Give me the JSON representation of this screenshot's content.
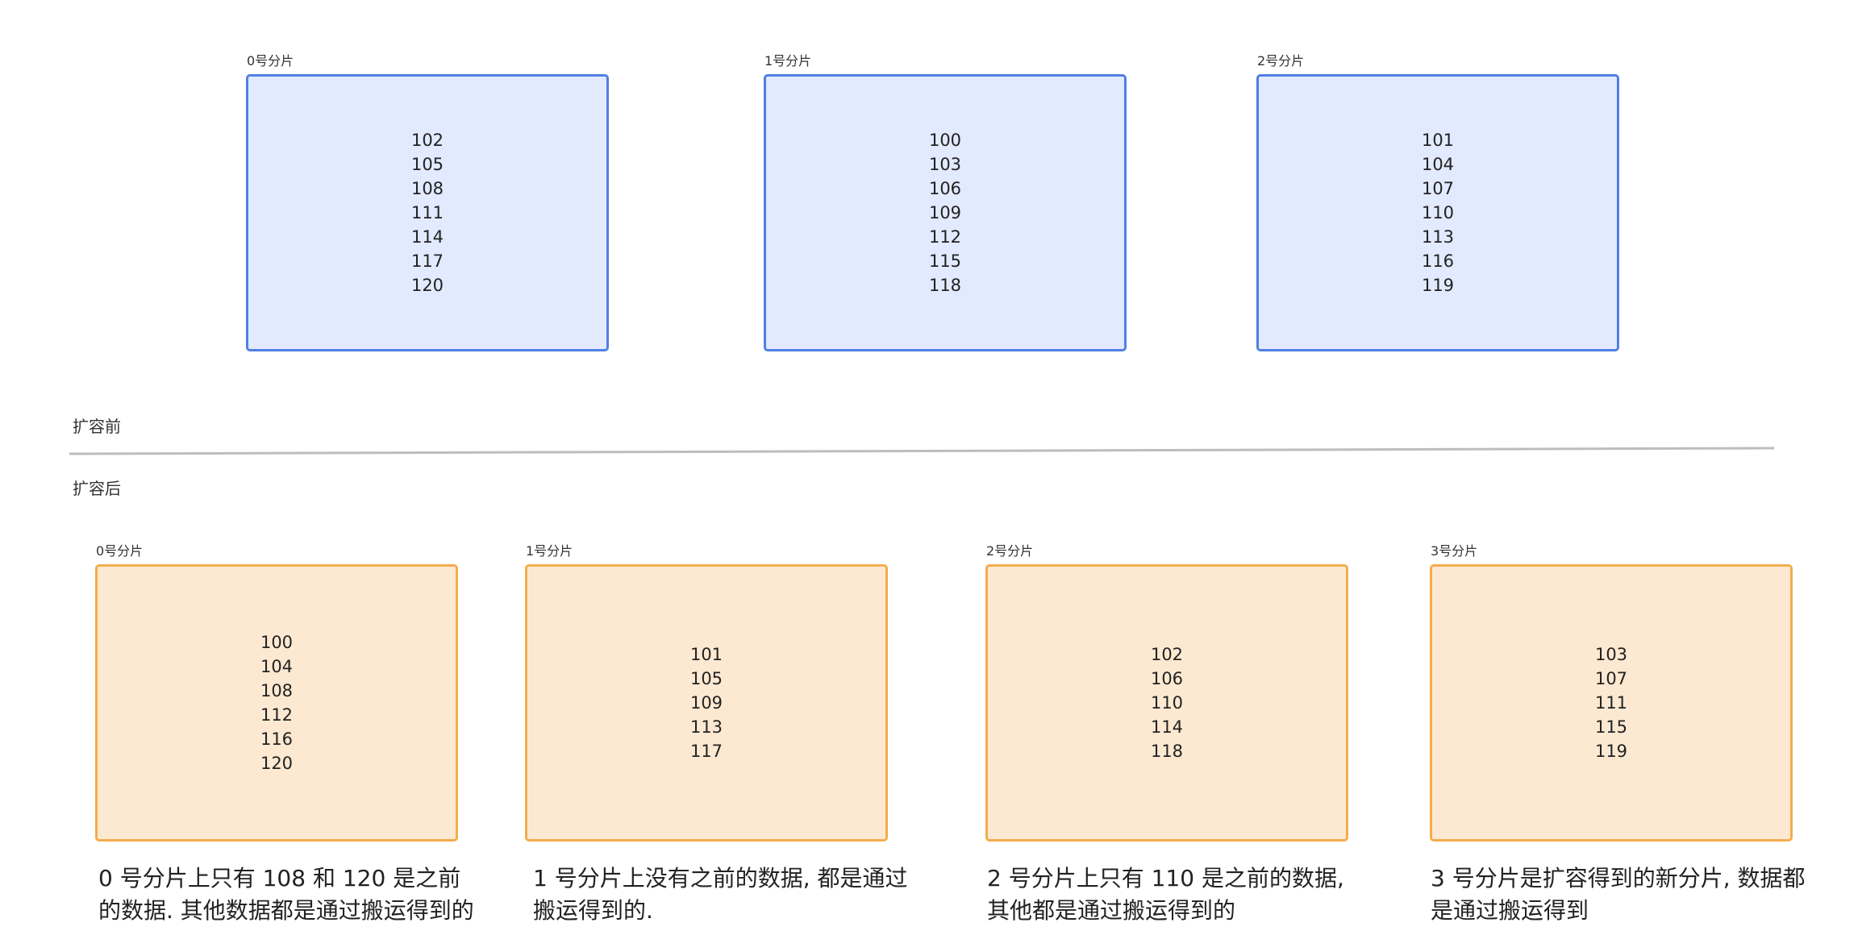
{
  "before": {
    "label": "扩容前",
    "shards": [
      {
        "name": "0号分片",
        "values": [
          "102",
          "105",
          "108",
          "111",
          "114",
          "117",
          "120"
        ]
      },
      {
        "name": "1号分片",
        "values": [
          "100",
          "103",
          "106",
          "109",
          "112",
          "115",
          "118"
        ]
      },
      {
        "name": "2号分片",
        "values": [
          "101",
          "104",
          "107",
          "110",
          "113",
          "116",
          "119"
        ]
      }
    ]
  },
  "after": {
    "label": "扩容后",
    "shards": [
      {
        "name": "0号分片",
        "values": [
          "100",
          "104",
          "108",
          "112",
          "116",
          "120"
        ],
        "note": "0 号分片上只有 108 和 120 是之前的数据. 其他数据都是通过搬运得到的"
      },
      {
        "name": "1号分片",
        "values": [
          "101",
          "105",
          "109",
          "113",
          "117"
        ],
        "note": "1 号分片上没有之前的数据, 都是通过搬运得到的."
      },
      {
        "name": "2号分片",
        "values": [
          "102",
          "106",
          "110",
          "114",
          "118"
        ],
        "note": "2 号分片上只有 110 是之前的数据, 其他都是通过搬运得到的"
      },
      {
        "name": "3号分片",
        "values": [
          "103",
          "107",
          "111",
          "115",
          "119"
        ],
        "note": "3 号分片是扩容得到的新分片, 数据都是通过搬运得到"
      }
    ]
  },
  "colors": {
    "before_fill": "#e1eafe",
    "before_stroke": "#4f7fe4",
    "after_fill": "#fde9d1",
    "after_stroke": "#f4ac4e",
    "divider": "#bdbdbd"
  }
}
